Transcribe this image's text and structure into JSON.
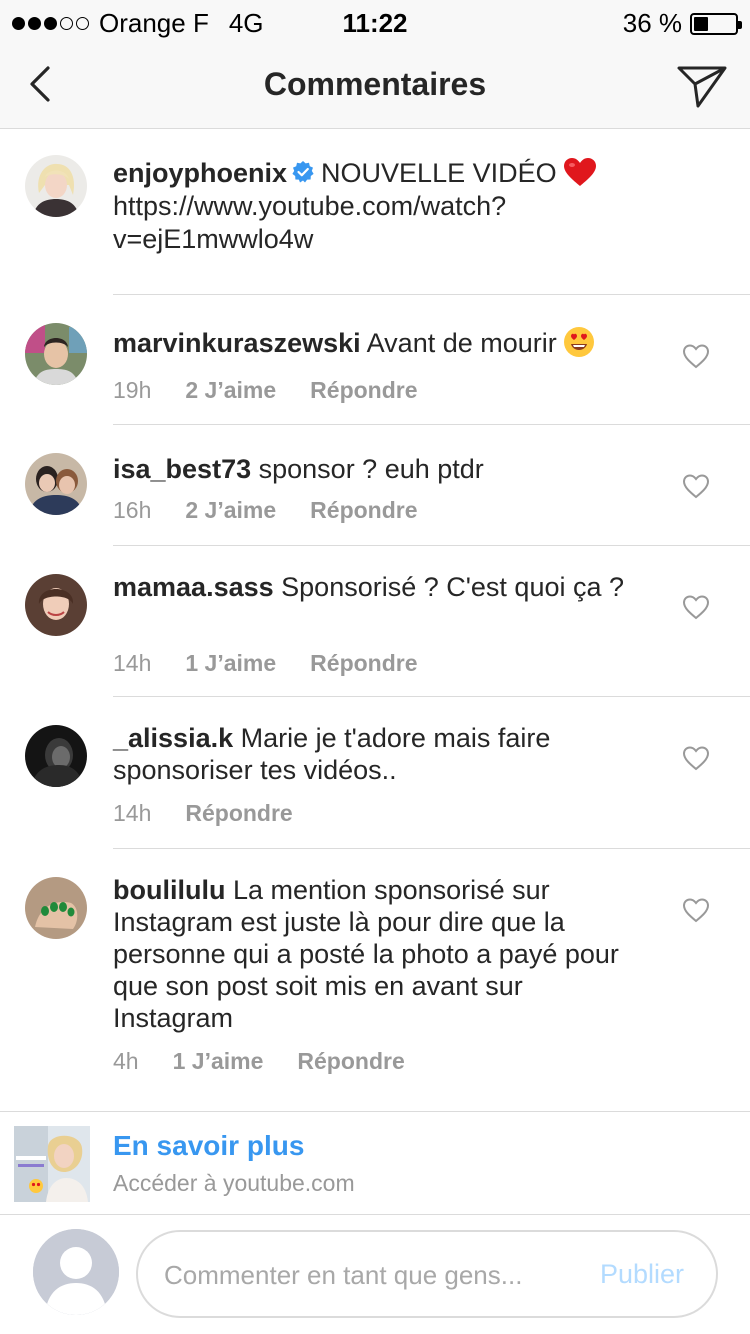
{
  "status_bar": {
    "carrier": "Orange F",
    "network": "4G",
    "time": "11:22",
    "battery": "36 %",
    "battery_level": 0.36,
    "signal_bars_filled": 3,
    "signal_bars_total": 5
  },
  "nav": {
    "title": "Commentaires",
    "back_icon": "chevron-left-icon",
    "send_icon": "paper-plane-icon"
  },
  "caption": {
    "username": "enjoyphoenix",
    "verified": true,
    "text": "NOUVELLE VIDÉO",
    "emoji": "red-heart",
    "link_line1": "https://www.youtube.com/watch?",
    "link_line2": "v=ejE1mwwlo4w"
  },
  "comments": [
    {
      "username": "marvinkuraszewski",
      "text": "Avant de mourir",
      "emoji": "heart-eyes-face",
      "time": "19h",
      "likes": "2 J’aime",
      "reply": "Répondre"
    },
    {
      "username": "isa_best73",
      "text": "sponsor ? euh ptdr",
      "time": "16h",
      "likes": "2 J’aime",
      "reply": "Répondre"
    },
    {
      "username": "mamaa.sass",
      "text": "Sponsorisé ? C'est quoi ça ?",
      "time": "14h",
      "likes": "1 J’aime",
      "reply": "Répondre"
    },
    {
      "username": "_alissia.k",
      "text": "Marie je t'adore mais faire sponsoriser tes vidéos..",
      "time": "14h",
      "likes": "",
      "reply": "Répondre"
    },
    {
      "username": "boulilulu",
      "text": "La mention sponsorisé sur Instagram est juste là pour dire que la personne qui a posté la photo a payé pour que son post soit mis en avant sur Instagram",
      "time": "4h",
      "likes": "1 J’aime",
      "reply": "Répondre"
    }
  ],
  "promo": {
    "cta": "En savoir plus",
    "subtitle": "Accéder à youtube.com",
    "accent": "#3897f0"
  },
  "composer": {
    "placeholder": "Commenter en tant que gens...",
    "publish": "Publier"
  },
  "colors": {
    "text": "#262626",
    "muted": "#999999",
    "separator": "#dbdbdb",
    "link": "#3897f0",
    "publish_disabled": "#b3dbff"
  }
}
